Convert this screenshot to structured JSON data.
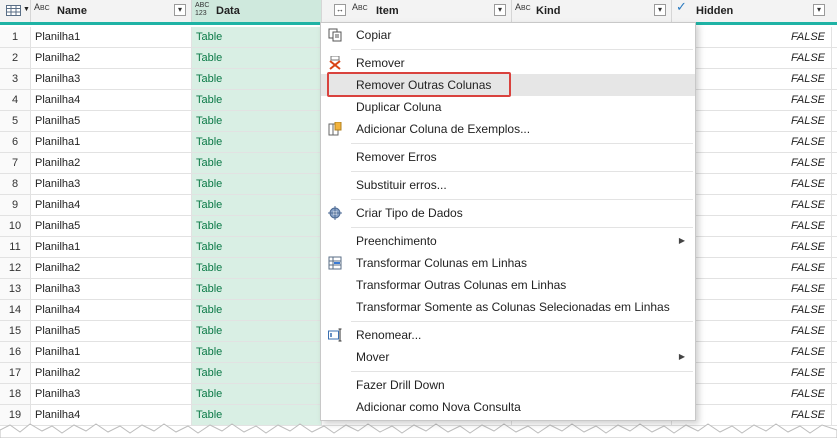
{
  "columns": [
    {
      "type_line1": "A",
      "type_line2": "BC",
      "title": "Name"
    },
    {
      "type_line1": "ABC",
      "type_line2": "123",
      "title": "Data"
    },
    {
      "type_line1": "A",
      "type_line2": "BC",
      "title": "Item"
    },
    {
      "type_line1": "A",
      "type_line2": "BC",
      "title": "Kind"
    },
    {
      "type_line1": "✓",
      "type_line2": "",
      "title": "Hidden"
    }
  ],
  "rows": [
    {
      "idx": "1",
      "name": "Planilha1",
      "data": "Table",
      "hidden": "FALSE"
    },
    {
      "idx": "2",
      "name": "Planilha2",
      "data": "Table",
      "hidden": "FALSE"
    },
    {
      "idx": "3",
      "name": "Planilha3",
      "data": "Table",
      "hidden": "FALSE"
    },
    {
      "idx": "4",
      "name": "Planilha4",
      "data": "Table",
      "hidden": "FALSE"
    },
    {
      "idx": "5",
      "name": "Planilha5",
      "data": "Table",
      "hidden": "FALSE"
    },
    {
      "idx": "6",
      "name": "Planilha1",
      "data": "Table",
      "hidden": "FALSE"
    },
    {
      "idx": "7",
      "name": "Planilha2",
      "data": "Table",
      "hidden": "FALSE"
    },
    {
      "idx": "8",
      "name": "Planilha3",
      "data": "Table",
      "hidden": "FALSE"
    },
    {
      "idx": "9",
      "name": "Planilha4",
      "data": "Table",
      "hidden": "FALSE"
    },
    {
      "idx": "10",
      "name": "Planilha5",
      "data": "Table",
      "hidden": "FALSE"
    },
    {
      "idx": "11",
      "name": "Planilha1",
      "data": "Table",
      "hidden": "FALSE"
    },
    {
      "idx": "12",
      "name": "Planilha2",
      "data": "Table",
      "hidden": "FALSE"
    },
    {
      "idx": "13",
      "name": "Planilha3",
      "data": "Table",
      "hidden": "FALSE"
    },
    {
      "idx": "14",
      "name": "Planilha4",
      "data": "Table",
      "hidden": "FALSE"
    },
    {
      "idx": "15",
      "name": "Planilha5",
      "data": "Table",
      "hidden": "FALSE"
    },
    {
      "idx": "16",
      "name": "Planilha1",
      "data": "Table",
      "hidden": "FALSE"
    },
    {
      "idx": "17",
      "name": "Planilha2",
      "data": "Table",
      "hidden": "FALSE"
    },
    {
      "idx": "18",
      "name": "Planilha3",
      "data": "Table",
      "hidden": "FALSE"
    },
    {
      "idx": "19",
      "name": "Planilha4",
      "data": "Table",
      "hidden": "FALSE"
    }
  ],
  "menu": {
    "copiar": "Copiar",
    "remover": "Remover",
    "remover_outras": "Remover Outras Colunas",
    "duplicar": "Duplicar Coluna",
    "adicionar_exemplos": "Adicionar Coluna de Exemplos...",
    "remover_erros": "Remover Erros",
    "substituir_erros": "Substituir erros...",
    "criar_tipo": "Criar Tipo de Dados",
    "preenchimento": "Preenchimento",
    "transformar_colunas": "Transformar Colunas em Linhas",
    "transformar_outras": "Transformar Outras Colunas em Linhas",
    "transformar_somente": "Transformar Somente as Colunas Selecionadas em Linhas",
    "renomear": "Renomear...",
    "mover": "Mover",
    "fazer_drill": "Fazer Drill Down",
    "adicionar_consulta": "Adicionar como Nova Consulta"
  },
  "icons": {
    "copy": "copy-icon",
    "remove": "remove-column-icon",
    "examples": "column-from-examples-icon",
    "data_type": "data-type-icon",
    "unpivot": "unpivot-icon",
    "rename": "rename-icon"
  },
  "colors": {
    "accent": "#1fb3a5",
    "selected_column": "#d9efe4",
    "table_text": "#0b7a47",
    "highlight_border": "#d9423e"
  }
}
